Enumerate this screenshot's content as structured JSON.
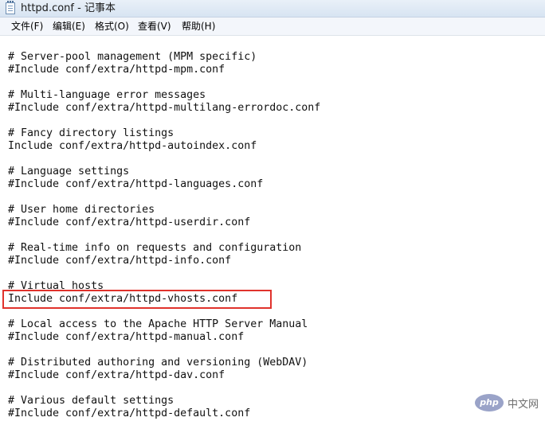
{
  "window": {
    "title": "httpd.conf - 记事本"
  },
  "menu": {
    "file": "文件(F)",
    "edit": "编辑(E)",
    "format": "格式(O)",
    "view": "查看(V)",
    "help": "帮助(H)"
  },
  "editor": {
    "lines": [
      "# Server-pool management (MPM specific)",
      "#Include conf/extra/httpd-mpm.conf",
      "",
      "# Multi-language error messages",
      "#Include conf/extra/httpd-multilang-errordoc.conf",
      "",
      "# Fancy directory listings",
      "Include conf/extra/httpd-autoindex.conf",
      "",
      "# Language settings",
      "#Include conf/extra/httpd-languages.conf",
      "",
      "# User home directories",
      "#Include conf/extra/httpd-userdir.conf",
      "",
      "# Real-time info on requests and configuration",
      "#Include conf/extra/httpd-info.conf",
      "",
      "# Virtual hosts",
      "Include conf/extra/httpd-vhosts.conf",
      "",
      "# Local access to the Apache HTTP Server Manual",
      "#Include conf/extra/httpd-manual.conf",
      "",
      "# Distributed authoring and versioning (WebDAV)",
      "#Include conf/extra/httpd-dav.conf",
      "",
      "# Various default settings",
      "#Include conf/extra/httpd-default.conf"
    ],
    "highlight_color": "#e0322c"
  },
  "watermark": {
    "logo": "php",
    "text": "中文网"
  }
}
